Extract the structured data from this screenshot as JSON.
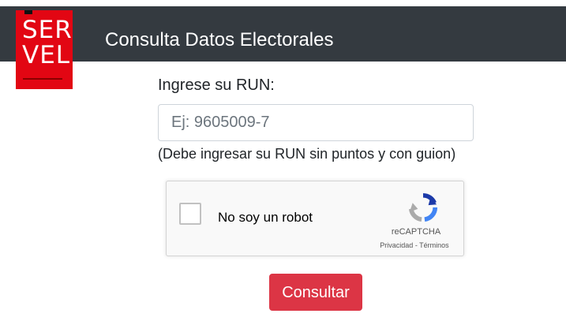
{
  "header": {
    "title": "Consulta Datos Electorales",
    "logo": {
      "line1": "SER",
      "line2": "VEL",
      "color": "#e20613"
    },
    "background_color": "#343a40"
  },
  "form": {
    "run_label": "Ingrese su RUN:",
    "run_placeholder": "Ej: 9605009-7",
    "run_value": "",
    "help_text": "(Debe ingresar su RUN sin puntos y con guion)",
    "submit_label": "Consultar",
    "submit_color": "#dc3545"
  },
  "captcha": {
    "label": "No soy un robot",
    "brand": "reCAPTCHA",
    "privacy_label": "Privacidad",
    "separator": " - ",
    "terms_label": "Términos",
    "checked": false,
    "icon": "recaptcha-icon"
  }
}
